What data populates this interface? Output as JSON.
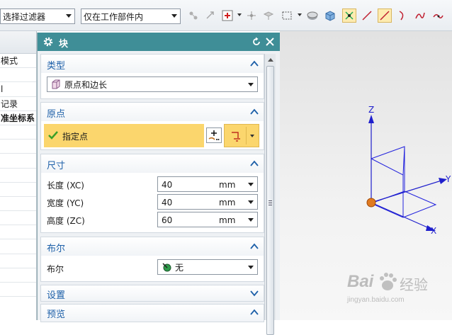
{
  "toolbar": {
    "filter_select": "选择过滤器",
    "scope_select": "仅在工作部件内"
  },
  "navigator": {
    "rows": [
      "模式",
      "",
      "l",
      "记录",
      "准坐标系",
      "",
      "",
      "",
      "",
      "",
      "",
      "",
      "",
      "",
      "",
      "",
      ""
    ]
  },
  "dialog": {
    "title": "块",
    "sections": {
      "type": {
        "label": "类型",
        "value": "原点和边长"
      },
      "origin": {
        "label": "原点",
        "specify_point": "指定点"
      },
      "dimensions": {
        "label": "尺寸",
        "rows": [
          {
            "label": "长度 (XC)",
            "value": "40",
            "unit": "mm"
          },
          {
            "label": "宽度 (YC)",
            "value": "40",
            "unit": "mm"
          },
          {
            "label": "高度 (ZC)",
            "value": "60",
            "unit": "mm"
          }
        ]
      },
      "boolean": {
        "label": "布尔",
        "row_label": "布尔",
        "value": "无"
      },
      "settings": {
        "label": "设置"
      },
      "preview": {
        "label": "预览"
      }
    }
  },
  "viewport": {
    "axis_z": "Z",
    "axis_y": "Y",
    "axis_x": "X"
  },
  "watermark": {
    "brand_a": "Bai",
    "brand_b": "经验",
    "url": "jingyan.baidu.com"
  },
  "colors": {
    "title_bar": "#3f8e97",
    "section_label": "#1c5fa8",
    "highlight_row": "#fbd66d",
    "axis_blue": "#1f1fcc",
    "origin_ball": "#e07a20"
  }
}
